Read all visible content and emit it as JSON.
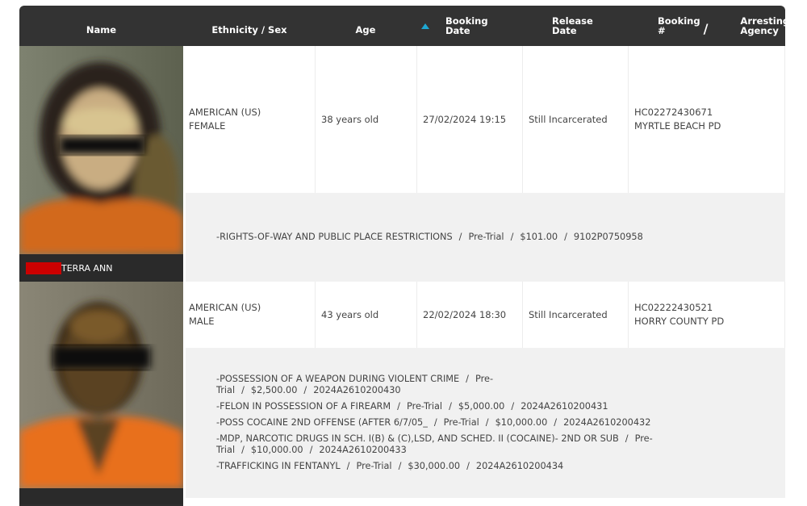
{
  "header": {
    "name": "Name",
    "ethnicity_sex": "Ethnicity / Sex",
    "age": "Age",
    "booking_date_line1": "Booking",
    "booking_date_line2": "Date",
    "release_date_line1": "Release",
    "release_date_line2": "Date",
    "booking_num_line1": "Booking",
    "booking_num_line2": "#",
    "separator": "/",
    "agency_line1": "Arresting",
    "agency_line2": "Agency",
    "sort_indicator": "sort-ascending-icon"
  },
  "colors": {
    "header_bg": "#333333",
    "sort_arrow": "#1ea7d2",
    "redaction": "#cc0000",
    "charges_bg": "#f1f1f1",
    "inmate_uniform": "#e8701a"
  },
  "records": [
    {
      "name": "TERRA ANN",
      "name_redacted": true,
      "ethnicity": "AMERICAN (US)",
      "sex": "FEMALE",
      "age": "38 years old",
      "booking_date": "27/02/2024 19:15",
      "release_date": "Still Incarcerated",
      "booking_number": "HC02272430671",
      "agency": "MYRTLE BEACH PD",
      "charges": [
        {
          "offense": "-RIGHTS-OF-WAY AND PUBLIC PLACE RESTRICTIONS",
          "status": "Pre-Trial",
          "bond": "$101.00",
          "case": "9102P0750958"
        }
      ]
    },
    {
      "name": "",
      "name_redacted": false,
      "ethnicity": "AMERICAN (US)",
      "sex": "MALE",
      "age": "43 years old",
      "booking_date": "22/02/2024 18:30",
      "release_date": "Still Incarcerated",
      "booking_number": "HC02222430521",
      "agency": "HORRY COUNTY PD",
      "charges": [
        {
          "offense": "-POSSESSION OF A WEAPON DURING VIOLENT CRIME",
          "status": "Pre-Trial",
          "bond": "$2,500.00",
          "case": "2024A2610200430"
        },
        {
          "offense": "-FELON IN POSSESSION OF A FIREARM",
          "status": "Pre-Trial",
          "bond": "$5,000.00",
          "case": "2024A2610200431"
        },
        {
          "offense": "-POSS COCAINE 2ND OFFENSE (AFTER 6/7/05_",
          "status": "Pre-Trial",
          "bond": "$10,000.00",
          "case": "2024A2610200432"
        },
        {
          "offense": "-MDP, NARCOTIC DRUGS IN SCH. I(B) & (C),LSD, AND SCHED. II (COCAINE)- 2ND OR SUB",
          "status": "Pre-Trial",
          "bond": "$10,000.00",
          "case": "2024A2610200433"
        },
        {
          "offense": "-TRAFFICKING IN FENTANYL",
          "status": "Pre-Trial",
          "bond": "$30,000.00",
          "case": "2024A2610200434"
        }
      ]
    }
  ]
}
